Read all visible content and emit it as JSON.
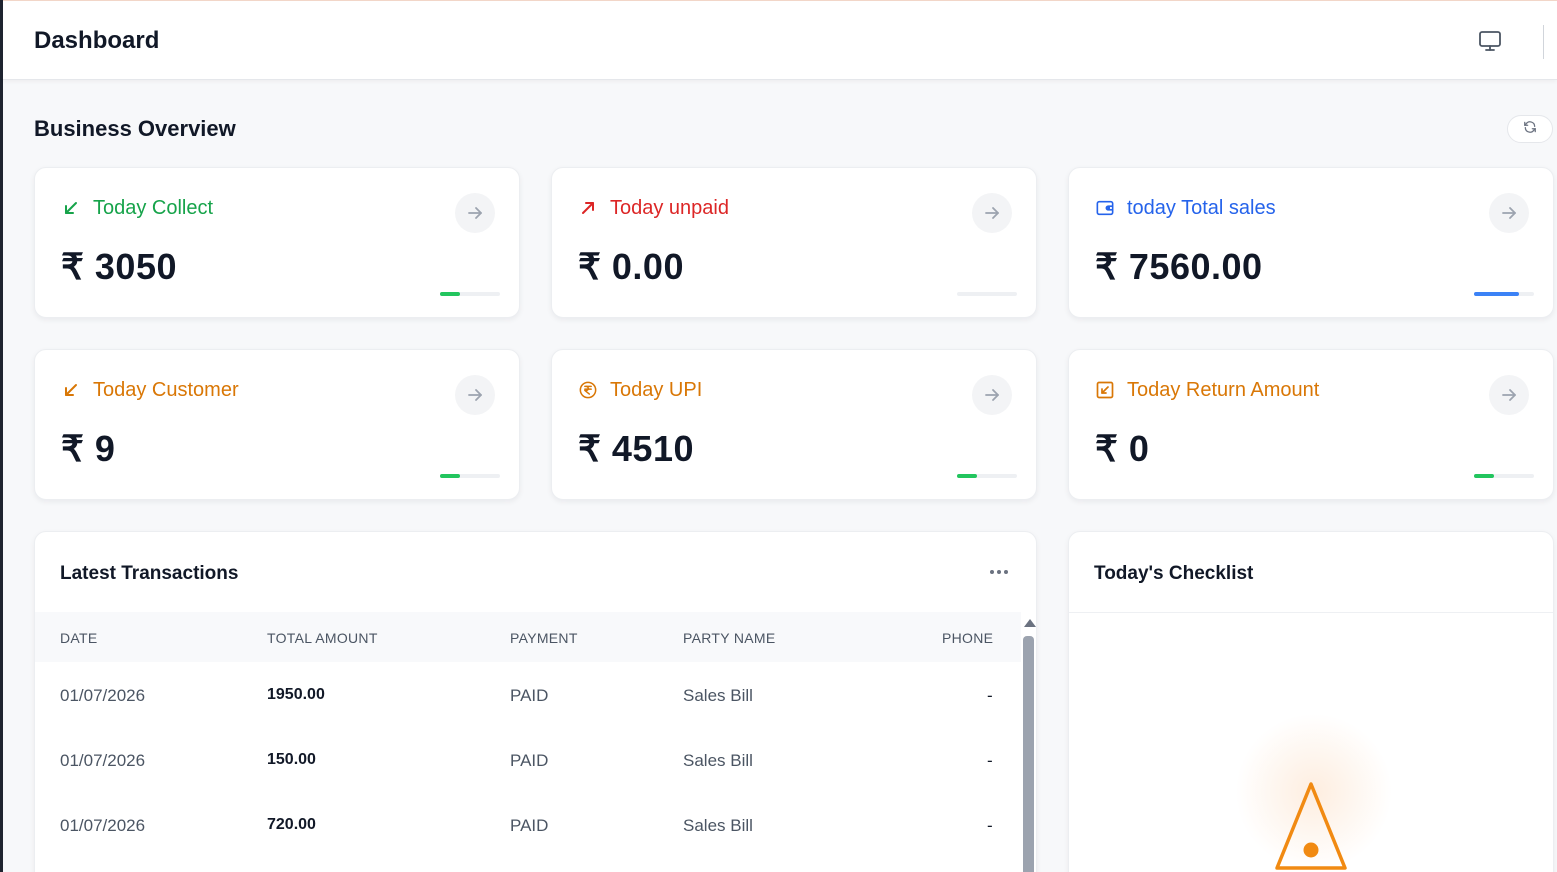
{
  "header": {
    "title": "Dashboard",
    "icon": "monitor-icon"
  },
  "overview": {
    "title": "Business Overview",
    "refresh_icon": "refresh-icon",
    "cards": [
      {
        "label": "Today Collect",
        "value": "₹ 3050",
        "color": "#16a34a",
        "icon": "arrow-down-left-icon",
        "progress": 0.33,
        "bar_color": "#22c55e"
      },
      {
        "label": "Today unpaid",
        "value": "₹ 0.00",
        "color": "#dc2626",
        "icon": "arrow-up-right-icon",
        "progress": 0,
        "bar_color": "#22c55e"
      },
      {
        "label": "today Total sales",
        "value": "₹ 7560.00",
        "color": "#2563eb",
        "icon": "wallet-icon",
        "progress": 0.75,
        "bar_color": "#3b82f6"
      },
      {
        "label": "Today Customer",
        "value": "₹ 9",
        "color": "#d97706",
        "icon": "arrow-down-left-icon",
        "progress": 0.33,
        "bar_color": "#22c55e"
      },
      {
        "label": "Today UPI",
        "value": "₹ 4510",
        "color": "#d97706",
        "icon": "rupee-circle-icon",
        "progress": 0.33,
        "bar_color": "#22c55e"
      },
      {
        "label": "Today Return Amount",
        "value": "₹ 0",
        "color": "#d97706",
        "icon": "return-box-icon",
        "progress": 0.33,
        "bar_color": "#22c55e"
      }
    ]
  },
  "transactions": {
    "title": "Latest Transactions",
    "columns": [
      "DATE",
      "TOTAL AMOUNT",
      "PAYMENT",
      "PARTY NAME",
      "PHONE"
    ],
    "rows": [
      {
        "date": "01/07/2026",
        "amount": "1950.00",
        "payment": "PAID",
        "party": "Sales Bill",
        "phone": "-"
      },
      {
        "date": "01/07/2026",
        "amount": "150.00",
        "payment": "PAID",
        "party": "Sales Bill",
        "phone": "-"
      },
      {
        "date": "01/07/2026",
        "amount": "720.00",
        "payment": "PAID",
        "party": "Sales Bill",
        "phone": "-"
      }
    ]
  },
  "checklist": {
    "title": "Today's Checklist",
    "icon": "warning-icon",
    "icon_color": "#f59e0b"
  }
}
